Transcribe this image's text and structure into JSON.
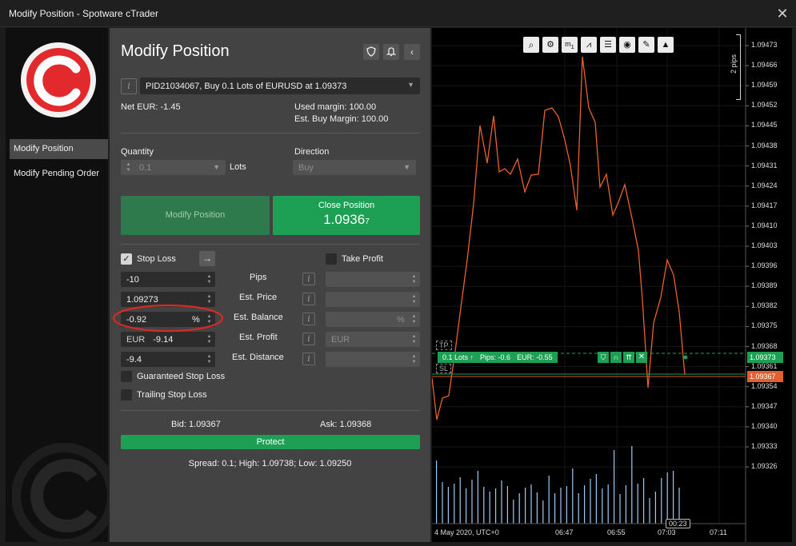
{
  "window": {
    "title": "Modify Position - Spotware cTrader",
    "close_glyph": "✕"
  },
  "sidebar": {
    "items": [
      {
        "label": "Modify Position",
        "active": true
      },
      {
        "label": "Modify Pending Order",
        "active": false
      }
    ]
  },
  "form": {
    "title": "Modify Position",
    "position_select": "PID21034067, Buy 0.1 Lots of EURUSD at 1.09373",
    "net_eur": "Net EUR: -1.45",
    "used_margin": "Used margin: 100.00",
    "est_buy_margin": "Est. Buy Margin: 100.00",
    "quantity_label": "Quantity",
    "quantity_value": "0.1",
    "lots_label": "Lots",
    "direction_label": "Direction",
    "direction_value": "Buy",
    "modify_button": "Modify Position",
    "close_button_label": "Close Position",
    "close_price_main": "1.0936",
    "close_price_pip": "7",
    "stop_loss": {
      "label": "Stop Loss",
      "checked": true,
      "pips": "-10",
      "price": "1.09273",
      "balance_pct": "-0.92",
      "pct_symbol": "%",
      "currency": "EUR",
      "profit": "-9.14",
      "distance": "-9.4"
    },
    "take_profit": {
      "label": "Take Profit",
      "checked": false,
      "pct_symbol": "%",
      "currency": "EUR"
    },
    "row_labels": [
      "Pips",
      "Est. Price",
      "Est. Balance",
      "Est. Profit",
      "Est. Distance"
    ],
    "info_glyph": "i",
    "guaranteed_sl": "Guaranteed Stop Loss",
    "trailing_sl": "Trailing Stop Loss",
    "bid": "Bid: 1.09367",
    "ask": "Ask: 1.09368",
    "protect_button": "Protect",
    "spread_line": "Spread: 0.1; High: 1.09738; Low: 1.09250"
  },
  "chart": {
    "toolbar_icons": [
      "zoom-icon",
      "chart-settings-icon",
      "timeframe-m1-icon",
      "chart-type-icon",
      "object-list-icon",
      "cbot-icon",
      "drawing-icon",
      "indicator-icon"
    ],
    "timeframe_label": "m",
    "timeframe_sub": "1",
    "y_ticks": [
      "1.09473",
      "1.09466",
      "1.09459",
      "1.09452",
      "1.09445",
      "1.09438",
      "1.09431",
      "1.09424",
      "1.09417",
      "1.09410",
      "1.09403",
      "1.09396",
      "1.09389",
      "1.09382",
      "1.09375",
      "1.09368",
      "1.09361",
      "1.09354",
      "1.09347",
      "1.09340",
      "1.09333",
      "1.09326"
    ],
    "x_date": "4 May 2020, UTC+0",
    "x_ticks": [
      "06:47",
      "06:55",
      "07:03",
      "07:11"
    ],
    "scale_label": "2 pips",
    "tp_tag": "TP",
    "sl_tag": "SL",
    "position_bar": {
      "lots": "0.1 Lots ↑",
      "pips": "Pips: -0.6",
      "eur": "EUR: -0.55"
    },
    "entry_price": "1.09373",
    "current_price": "1.09367",
    "countdown": "00:23",
    "colors": {
      "line": "#e8622a",
      "position": "#1ea054",
      "sl_line": "#d4552a",
      "volume": "#9fc8ef"
    }
  }
}
